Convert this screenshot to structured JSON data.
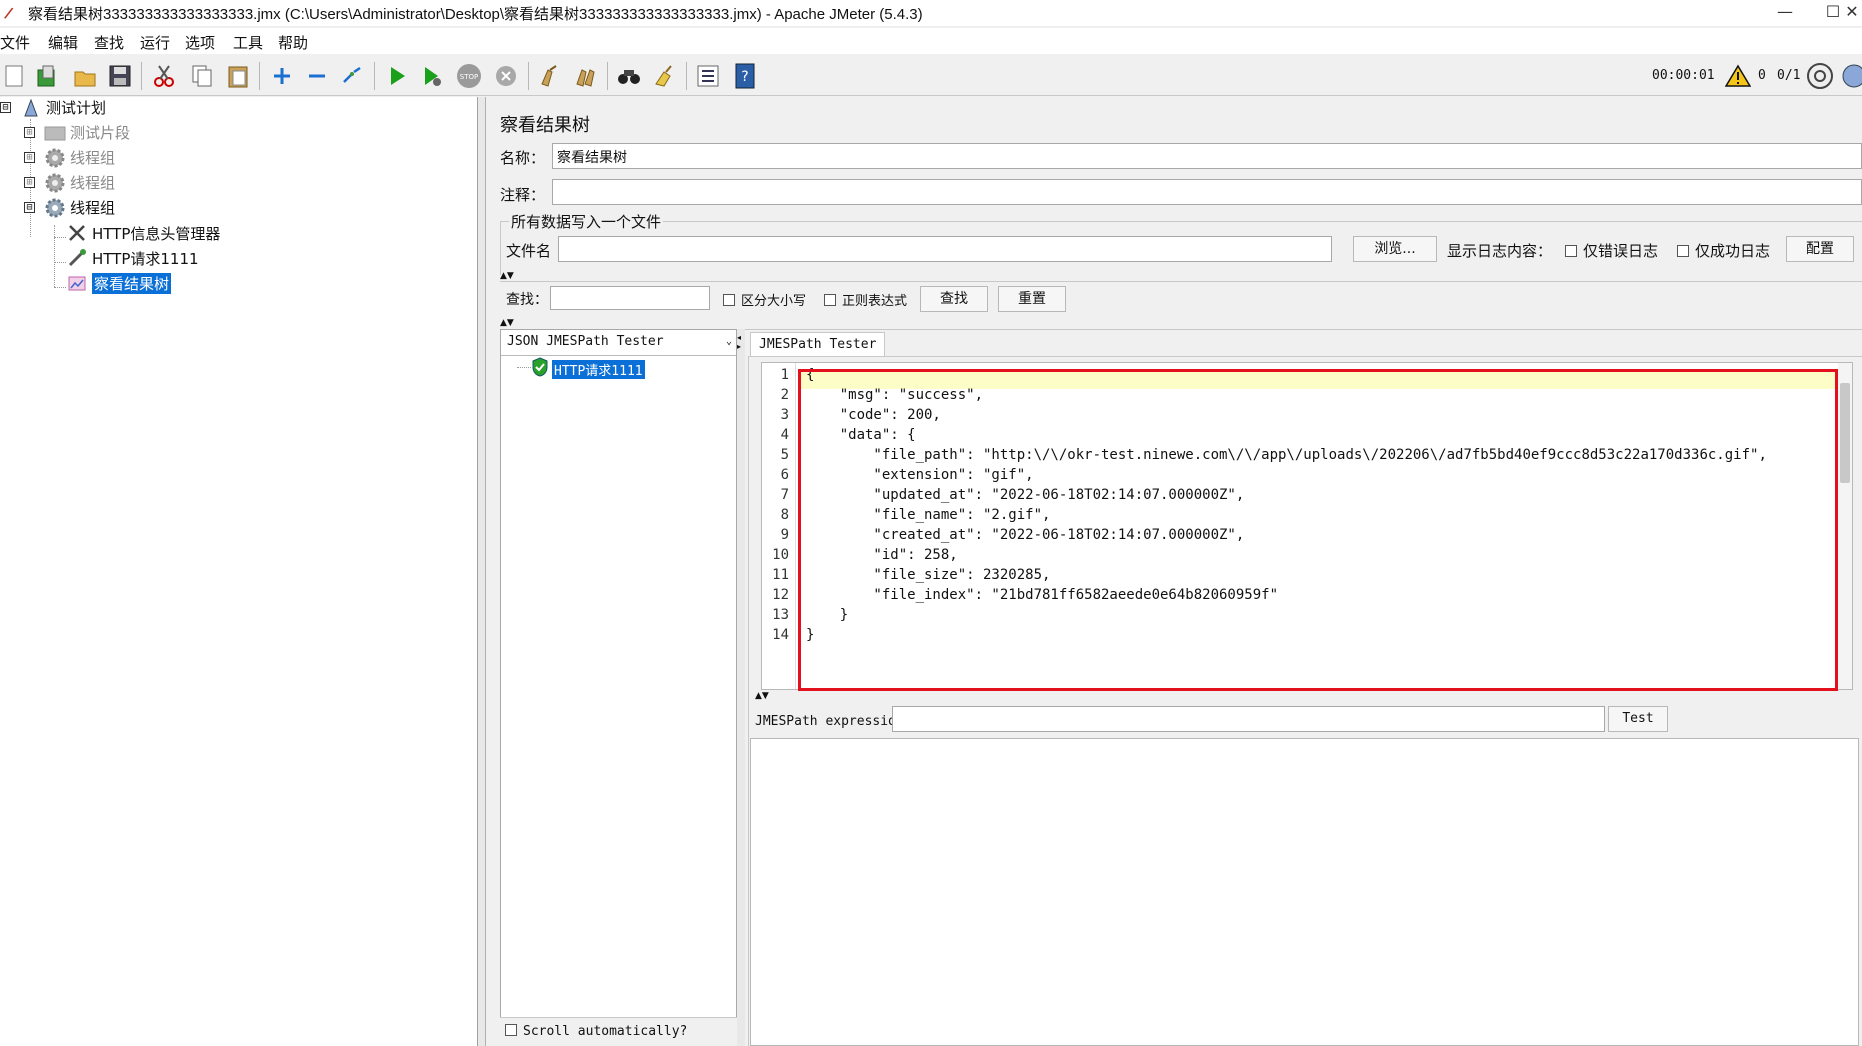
{
  "window": {
    "title": "察看结果树333333333333333333.jmx (C:\\Users\\Administrator\\Desktop\\察看结果树333333333333333333.jmx) - Apache JMeter (5.4.3)",
    "minimize": "—",
    "maximize": "☐",
    "close": "✕"
  },
  "menu": [
    "文件",
    "编辑",
    "查找",
    "运行",
    "选项",
    "工具",
    "帮助"
  ],
  "toolbar": {
    "timer": "00:00:01",
    "warning_count": "0",
    "threads": "0/1",
    "icons": [
      "new-icon",
      "templates-icon",
      "open-icon",
      "save-icon",
      "cut-icon",
      "copy-icon",
      "paste-icon",
      "expand-icon",
      "collapse-icon",
      "toggle-icon",
      "start-icon",
      "start-no-pause-icon",
      "stop-icon",
      "shutdown-icon",
      "clear-icon",
      "clear-all-icon",
      "search-icon",
      "reset-search-icon",
      "function-helper-icon",
      "help-icon",
      "warning-icon",
      "remote-icon",
      "globe-icon"
    ]
  },
  "tree": {
    "items": [
      {
        "label": "测试计划",
        "icon": "test-plan-icon",
        "expander": "⊟"
      },
      {
        "label": "测试片段",
        "icon": "test-fragment-icon",
        "expander": "⊞"
      },
      {
        "label": "线程组",
        "icon": "thread-group-icon",
        "expander": "⊞"
      },
      {
        "label": "线程组",
        "icon": "thread-group-icon",
        "expander": "⊞"
      },
      {
        "label": "线程组",
        "icon": "thread-group-icon",
        "expander": "⊟"
      },
      {
        "label": "HTTP信息头管理器",
        "icon": "header-manager-icon"
      },
      {
        "label": "HTTP请求1111",
        "icon": "http-sampler-icon"
      },
      {
        "label": "察看结果树",
        "icon": "results-tree-icon",
        "selected": true
      }
    ]
  },
  "panel": {
    "title": "察看结果树",
    "name_label": "名称：",
    "name_value": "察看结果树",
    "comment_label": "注释：",
    "comment_value": "",
    "file_group_title": "所有数据写入一个文件",
    "filename_label": "文件名",
    "filename_value": "",
    "browse_button": "浏览...",
    "log_display_label": "显示日志内容：",
    "errors_only_label": "仅错误日志",
    "success_only_label": "仅成功日志",
    "configure_button": "配置",
    "search_label": "查找：",
    "search_value": "",
    "case_sensitive_label": "区分大小写",
    "regex_label": "正则表达式",
    "find_button": "查找",
    "reset_button": "重置",
    "renderer_value": "JSON JMESPath Tester",
    "result_item": "HTTP请求1111",
    "scroll_auto_label": "Scroll automatically?",
    "tab_label": "JMESPath Tester",
    "jmespath_label": "JMESPath expression",
    "jmespath_value": "",
    "test_button": "Test",
    "result_text": ""
  },
  "response_json": {
    "line_numbers": [
      "1",
      "2",
      "3",
      "4",
      "5",
      "6",
      "7",
      "8",
      "9",
      "10",
      "11",
      "12",
      "13",
      "14"
    ],
    "lines": [
      "{",
      "    \"msg\": \"success\",",
      "    \"code\": 200,",
      "    \"data\": {",
      "        \"file_path\": \"http:\\/\\/okr-test.ninewe.com\\/\\/app\\/uploads\\/202206\\/ad7fb5bd40ef9ccc8d53c22a170d336c.gif\",",
      "        \"extension\": \"gif\",",
      "        \"updated_at\": \"2022-06-18T02:14:07.000000Z\",",
      "        \"file_name\": \"2.gif\",",
      "        \"created_at\": \"2022-06-18T02:14:07.000000Z\",",
      "        \"id\": 258,",
      "        \"file_size\": 2320285,",
      "        \"file_index\": \"21bd781ff6582aeede0e64b82060959f\"",
      "    }",
      "}"
    ]
  },
  "colors": {
    "highlight": "#e3101e",
    "selection": "#0a6fd6",
    "current_line": "#fdfdc8"
  }
}
